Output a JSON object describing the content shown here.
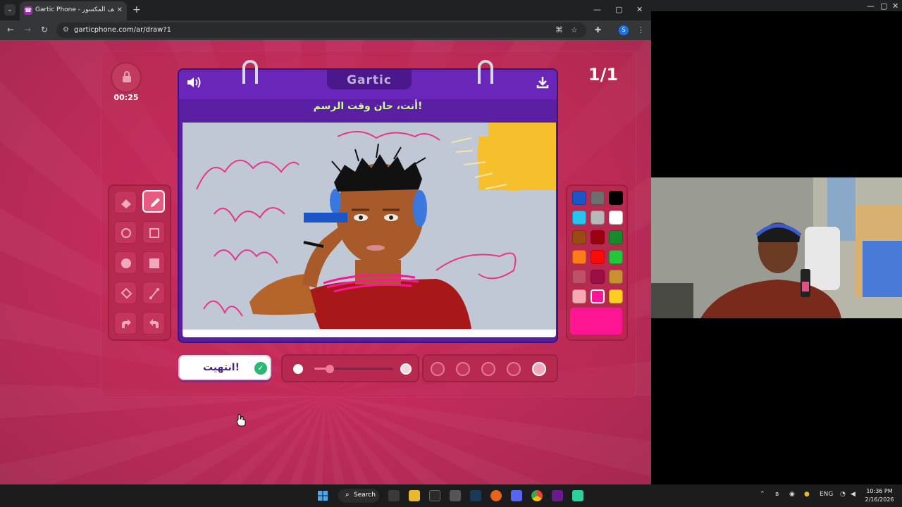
{
  "browser": {
    "tab_title": "Gartic Phone - الهاتف المكسور",
    "tab_close": "✕",
    "new_tab": "+",
    "url": "garticphone.com/ar/draw?1",
    "window_controls": {
      "minimize": "—",
      "maximize": "▢",
      "close": "✕"
    }
  },
  "game": {
    "timer": "00:25",
    "round": "1/1",
    "logo": "Gartic",
    "prompt": "أنت، حان وقت الرسم!",
    "done_button": "انتهيت!",
    "tools": [
      "eraser-tool",
      "pencil-tool",
      "circle-outline-tool",
      "square-outline-tool",
      "circle-fill-tool",
      "square-fill-tool",
      "fill-bucket-tool",
      "line-tool",
      "undo-tool",
      "redo-tool"
    ],
    "active_tool": "pencil-tool",
    "palette": [
      "#1a56c8",
      "#6e6e6e",
      "#000000",
      "#29c3f0",
      "#b8b8b8",
      "#ffffff",
      "#9b4a12",
      "#9c0011",
      "#168a2a",
      "#ff7a1a",
      "#ff0a0a",
      "#22c83a",
      "#c05068",
      "#9c0f45",
      "#c89030",
      "#f8a8b0",
      "#ff1493",
      "#ffcc22"
    ],
    "selected_color": "#ff1493",
    "brush_size_fraction": 0.2,
    "opacity_selected_index": 4
  },
  "taskbar": {
    "search_label": "Search",
    "lang": "ENG",
    "time": "10:36 PM",
    "date": "2/16/2026"
  }
}
